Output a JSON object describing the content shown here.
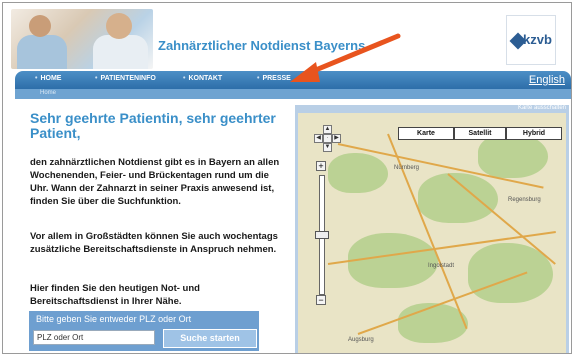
{
  "header": {
    "title": "Zahnärztlicher Notdienst Bayerns",
    "logo_text": "kzvb"
  },
  "nav": {
    "items": [
      "HOME",
      "PATIENTENINFO",
      "KONTAKT",
      "PRESSE"
    ],
    "language": "English",
    "breadcrumb": "Home"
  },
  "main": {
    "greeting": "Sehr geehrte Patientin, sehr geehrter Patient,",
    "paragraphs": [
      "den zahnärztlichen Notdienst gibt es in Bayern an allen Wochenenden, Feier- und Brückentagen rund um die Uhr. Wann der Zahnarzt in seiner Praxis anwesend ist, finden Sie über die Suchfunktion.",
      "Vor allem in Großstädten können Sie auch wochentags zusätzliche Bereitschaftsdienste in Anspruch nehmen.",
      "Hier finden Sie den heutigen Not- und Bereitschaftsdienst in Ihrer Nähe."
    ]
  },
  "search": {
    "caption": "Bitte geben Sie entweder PLZ oder Ort",
    "input_value": "PLZ oder Ort",
    "button_label": "Suche starten"
  },
  "map": {
    "top_link": "Karte ausschalten",
    "type_buttons": [
      "Karte",
      "Satellit",
      "Hybrid"
    ],
    "towns": [
      "Nürnberg",
      "Regensburg",
      "Ingolstadt",
      "Augsburg"
    ],
    "zoom_in": "+",
    "zoom_out": "−"
  },
  "annotation": {
    "arrow_color": "#e8541e"
  }
}
